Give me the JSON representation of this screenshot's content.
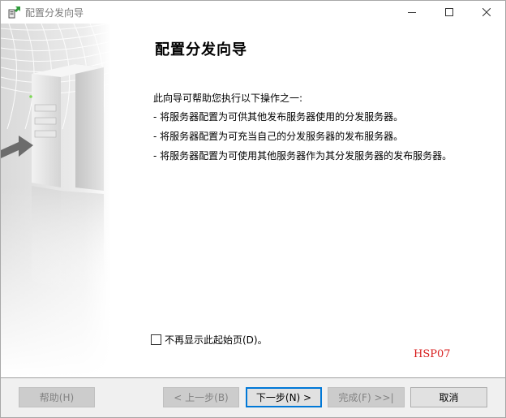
{
  "titlebar": {
    "title": "配置分发向导",
    "icon": "wizard-server-icon",
    "minimize_icon": "minimize-icon",
    "maximize_icon": "maximize-icon",
    "close_icon": "close-icon"
  },
  "banner": {
    "image": "server-with-arrow-illustration"
  },
  "main": {
    "heading": "配置分发向导",
    "intro": "此向导可帮助您执行以下操作之一:",
    "bullets": [
      "- 将服务器配置为可供其他发布服务器使用的分发服务器。",
      "- 将服务器配置为可充当自己的分发服务器的发布服务器。",
      "- 将服务器配置为可使用其他服务器作为其分发服务器的发布服务器。"
    ],
    "checkbox": {
      "label": "不再显示此起始页(D)。",
      "checked": false
    },
    "watermark": "HSP07"
  },
  "footer": {
    "help_label": "帮助(H)",
    "back_label": "< 上一步(B)",
    "next_label": "下一步(N) >",
    "finish_label": "完成(F) >>|",
    "cancel_label": "取消"
  },
  "colors": {
    "accent": "#0078d7",
    "watermark": "#d81e1e",
    "footer_bg": "#f0f0f0",
    "disabled_text": "#838383"
  }
}
